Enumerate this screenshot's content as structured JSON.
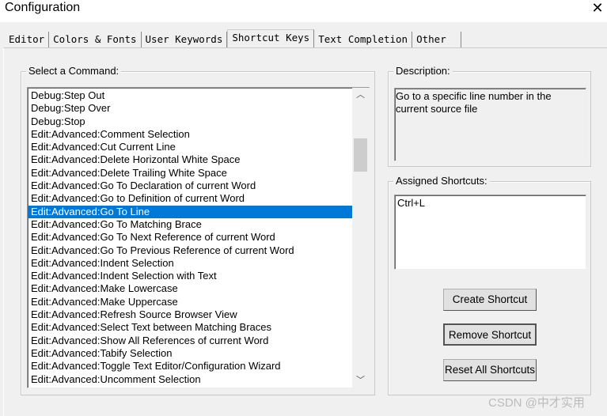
{
  "window": {
    "title": "Configuration",
    "close_icon": "close-icon"
  },
  "tabs": [
    {
      "label": "Editor"
    },
    {
      "label": "Colors & Fonts"
    },
    {
      "label": "User Keywords"
    },
    {
      "label": "Shortcut Keys",
      "active": true
    },
    {
      "label": "Text Completion"
    },
    {
      "label": "Other"
    }
  ],
  "commands": {
    "label": "Select a Command:",
    "selected": "Edit:Advanced:Go To Line",
    "items": [
      "Debug:Step Out",
      "Debug:Step Over",
      "Debug:Stop",
      "Edit:Advanced:Comment Selection",
      "Edit:Advanced:Cut Current Line",
      "Edit:Advanced:Delete Horizontal White Space",
      "Edit:Advanced:Delete Trailing White Space",
      "Edit:Advanced:Go To Declaration of current Word",
      "Edit:Advanced:Go to Definition of current Word",
      "Edit:Advanced:Go To Line",
      "Edit:Advanced:Go To Matching Brace",
      "Edit:Advanced:Go To Next Reference of current Word",
      "Edit:Advanced:Go To Previous Reference of current Word",
      "Edit:Advanced:Indent Selection",
      "Edit:Advanced:Indent Selection with Text",
      "Edit:Advanced:Make Lowercase",
      "Edit:Advanced:Make Uppercase",
      "Edit:Advanced:Refresh Source Browser View",
      "Edit:Advanced:Select Text between Matching Braces",
      "Edit:Advanced:Show All References of current Word",
      "Edit:Advanced:Tabify Selection",
      "Edit:Advanced:Toggle Text Editor/Configuration Wizard",
      "Edit:Advanced:Uncomment Selection"
    ]
  },
  "description": {
    "label": "Description:",
    "text": "Go to a specific line number in the current source file"
  },
  "shortcuts": {
    "label": "Assigned Shortcuts:",
    "items": [
      "Ctrl+L"
    ]
  },
  "buttons": {
    "create": "Create Shortcut",
    "remove": "Remove Shortcut",
    "reset": "Reset All Shortcuts"
  },
  "watermark": "CSDN @中才实用",
  "colors": {
    "selection": "#0078d7",
    "background": "#f0f0f0"
  }
}
